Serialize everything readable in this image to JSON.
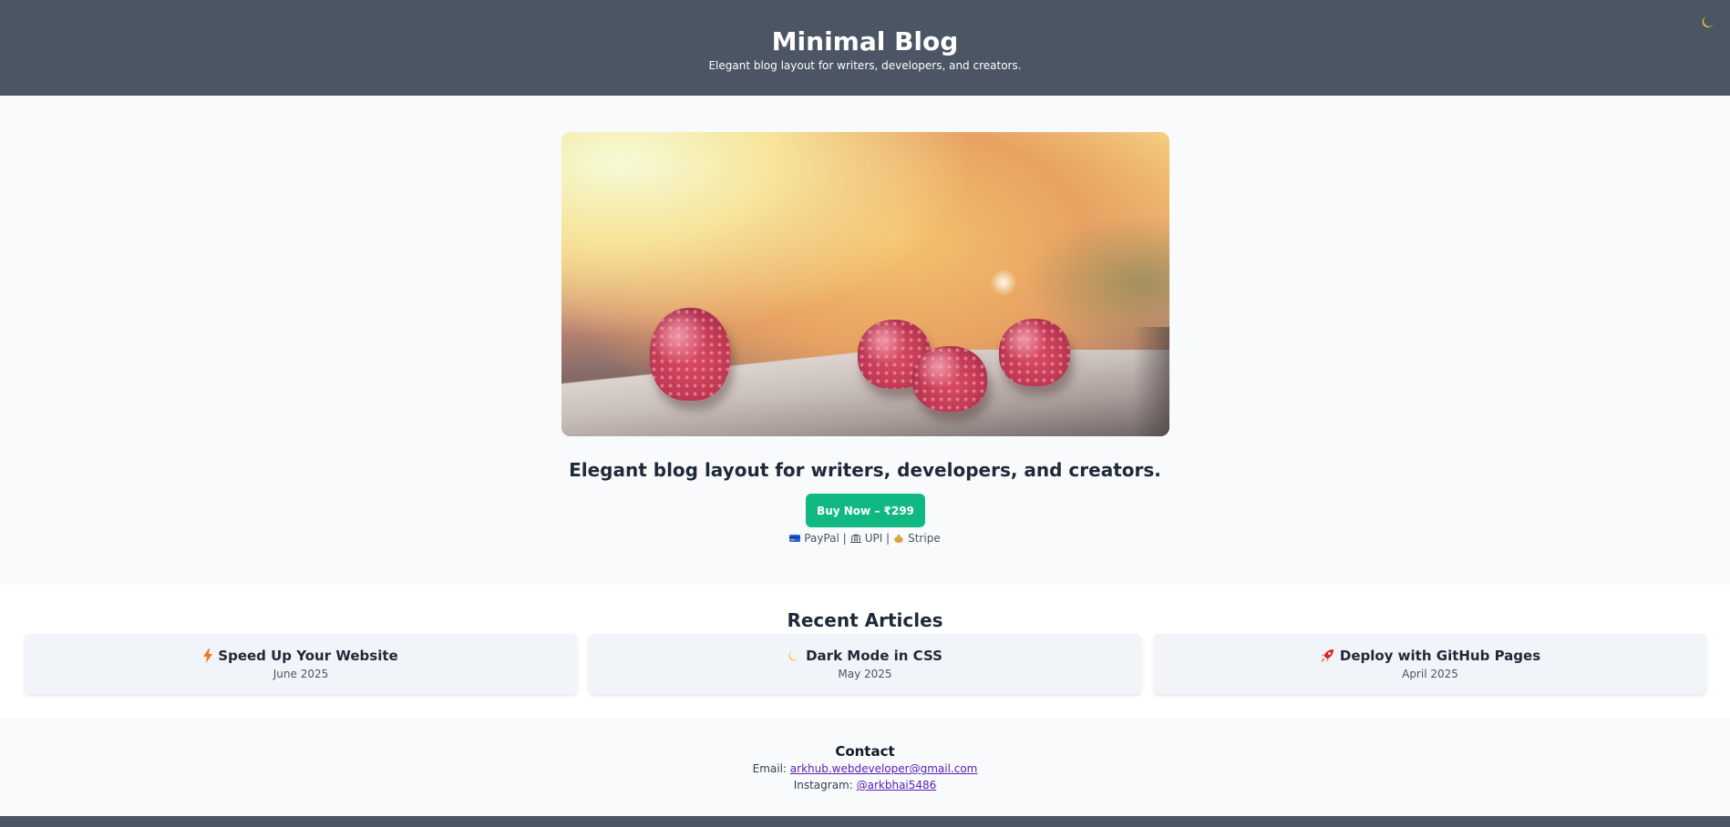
{
  "header": {
    "title": "Minimal Blog",
    "tagline": "Elegant blog layout for writers, developers, and creators.",
    "theme_toggle_icon": "moon-icon"
  },
  "hero": {
    "image_description": "raspberries-on-table",
    "heading": "Elegant blog layout for writers, developers, and creators.",
    "buy_button_label": "Buy Now – ₹299",
    "payment": {
      "paypal": "PayPal |",
      "upi": "UPI |",
      "stripe": "Stripe"
    }
  },
  "articles": {
    "title": "Recent Articles",
    "items": [
      {
        "icon": "lightning-icon",
        "title": "Speed Up Your Website",
        "date": "June 2025"
      },
      {
        "icon": "moon-icon",
        "title": "Dark Mode in CSS",
        "date": "May 2025"
      },
      {
        "icon": "rocket-icon",
        "title": "Deploy with GitHub Pages",
        "date": "April 2025"
      }
    ]
  },
  "contact": {
    "title": "Contact",
    "email_label": "Email:",
    "email": "arkhub.webdeveloper@gmail.com",
    "instagram_label": "Instagram:",
    "instagram": "@arkbhai5486"
  },
  "colors": {
    "header_bg": "#4b5563",
    "accent_green": "#10b981",
    "link_purple": "#5b21b6",
    "card_bg": "#f1f4f8"
  }
}
